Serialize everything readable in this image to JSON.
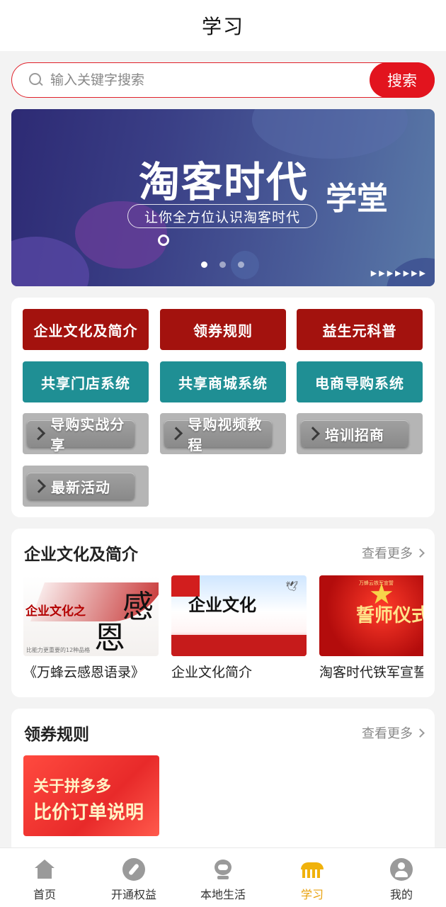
{
  "header": {
    "title": "学习"
  },
  "search": {
    "placeholder": "输入关键字搜索",
    "button_label": "搜索"
  },
  "banner": {
    "main_text": "淘客时代",
    "sub_word": "学堂",
    "tagline": "让你全方位认识淘客时代",
    "slide_count": 3,
    "active_slide": 1
  },
  "menu": {
    "red": [
      "企业文化及简介",
      "领券规则",
      "益生元科普"
    ],
    "teal": [
      "共享门店系统",
      "共享商城系统",
      "电商导购系统"
    ],
    "grey": [
      "导购实战分享",
      "导购视频教程",
      "培训招商",
      "最新活动"
    ]
  },
  "culture_section": {
    "title": "企业文化及简介",
    "more_label": "查看更多",
    "items": [
      {
        "caption": "《万蜂云感恩语录》",
        "thumb_text": "企业文化之",
        "thumb_big1": "感",
        "thumb_big2": "恩",
        "thumb_small": "比能力更重要的12种品格"
      },
      {
        "caption": "企业文化简介",
        "thumb_text": "企业文化"
      },
      {
        "caption": "淘客时代铁军宣誓",
        "thumb_text": "誓师仪式",
        "thumb_small": "万蜂云铁军宣誓"
      }
    ]
  },
  "coupon_section": {
    "title": "领券规则",
    "more_label": "查看更多",
    "thumb_line1": "关于拼多多",
    "thumb_line2": "比价订单说明"
  },
  "tabbar": {
    "items": [
      {
        "label": "首页",
        "icon": "home-icon"
      },
      {
        "label": "开通权益",
        "icon": "compass-icon"
      },
      {
        "label": "本地生活",
        "icon": "robot-icon"
      },
      {
        "label": "学习",
        "icon": "study-icon"
      },
      {
        "label": "我的",
        "icon": "user-icon"
      }
    ],
    "active_index": 3
  },
  "colors": {
    "brand_red": "#e2141e",
    "menu_red": "#a3120e",
    "menu_teal": "#1f8f94",
    "tab_active": "#e8a10c"
  }
}
